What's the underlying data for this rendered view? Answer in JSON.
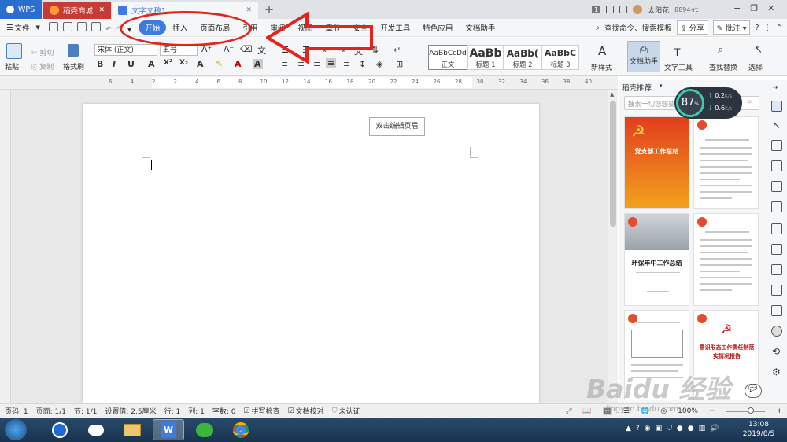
{
  "titlebar": {
    "tabs": [
      {
        "label": "WPS"
      },
      {
        "label": "稻壳商城"
      },
      {
        "label": "文字文稿1"
      }
    ],
    "new_tab": "+",
    "badge": "1",
    "user": "太阳花",
    "user_id": "8894-rc"
  },
  "menubar": {
    "file": "文件",
    "items": [
      "开始",
      "插入",
      "页面布局",
      "引用",
      "审阅",
      "视图",
      "章节",
      "安全",
      "开发工具",
      "特色应用",
      "文档助手"
    ],
    "search": "查找命令、搜索模板",
    "share": "分享",
    "annotate": "批注",
    "help": "?"
  },
  "ribbon": {
    "paste": "粘贴",
    "cut": "剪切",
    "copy": "复制",
    "format_painter": "格式刷",
    "font": "宋体 (正文)",
    "size": "五号",
    "styles": [
      {
        "preview": "AaBbCcDd",
        "name": "正文"
      },
      {
        "preview": "AaBb",
        "name": "标题 1"
      },
      {
        "preview": "AaBb(",
        "name": "标题 2"
      },
      {
        "preview": "AaBbC",
        "name": "标题 3"
      }
    ],
    "new_style": "新样式",
    "doc_assistant": "文档助手",
    "text_tools": "文字工具",
    "find_replace": "查找替换",
    "select": "选择"
  },
  "ruler": [
    "6",
    "4",
    "2",
    "2",
    "4",
    "6",
    "8",
    "10",
    "12",
    "14",
    "16",
    "18",
    "20",
    "22",
    "24",
    "26",
    "28",
    "30",
    "32",
    "34",
    "36",
    "38",
    "40"
  ],
  "page": {
    "header_button": "双击编辑页眉"
  },
  "panel": {
    "title": "稻壳推荐",
    "search_placeholder": "搜索一切您想要",
    "speed_percent": "87",
    "speed_unit": "%",
    "up_speed": "0.2",
    "down_speed": "0.6",
    "speed_unit_label": "K/s",
    "thumbs": [
      {
        "title": "党支部工作总结"
      },
      {
        "title": ""
      },
      {
        "title": "环保年中工作总结"
      },
      {
        "title": ""
      },
      {
        "title": ""
      },
      {
        "title": "意识形态工作责任制落实情况报告"
      }
    ]
  },
  "status": {
    "page_num": "页码: 1",
    "pages": "页面: 1/1",
    "section": "节: 1/1",
    "setting": "设置值: 2.5厘米",
    "row": "行: 1",
    "col": "列: 1",
    "words": "字数: 0",
    "spell": "拼写检查",
    "proof": "文档校对",
    "cert": "未认证",
    "zoom": "100%"
  },
  "taskbar": {
    "time": "13:08",
    "date": "2019/8/5"
  },
  "watermark": {
    "text": "Baidu 经验",
    "sub": "jingyan.baidu.com"
  }
}
